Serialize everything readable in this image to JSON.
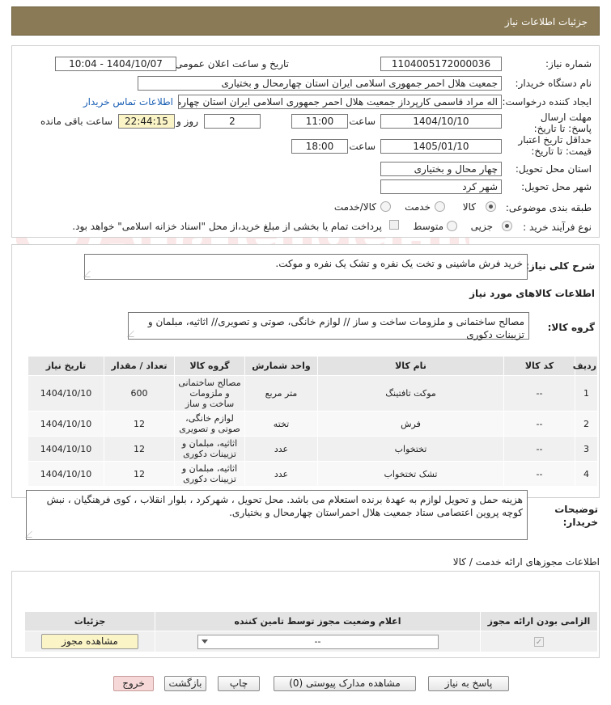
{
  "header": {
    "title": "جزئیات اطلاعات نیاز"
  },
  "fields": {
    "need_number_label": "شماره نیاز:",
    "need_number": "1104005172000036",
    "announce_label": "تاریخ و ساعت اعلان عمومی:",
    "announce_value": "1404/10/07 - 10:04",
    "buyer_org_label": "نام دستگاه خریدار:",
    "buyer_org": "جمعیت هلال احمر جمهوری اسلامی ایران استان چهارمحال و بختیاری",
    "requester_label": "ایجاد کننده درخواست:",
    "requester": "اله مراد قاسمی کارپرداز جمعیت هلال احمر جمهوری اسلامی ایران استان چهارمحال و بختیاری",
    "contact_link": "اطلاعات تماس خریدار",
    "reply_deadline_label": "مهلت ارسال پاسخ: تا تاریخ:",
    "reply_date": "1404/10/10",
    "time_label": "ساعت",
    "reply_time": "11:00",
    "days_value": "2",
    "days_and_label": "روز و",
    "remaining_time": "22:44:15",
    "remaining_label": "ساعت باقی مانده",
    "price_validity_label": "حداقل تاریخ اعتبار قیمت: تا تاریخ:",
    "validity_date": "1405/01/10",
    "validity_time": "18:00",
    "province_label": "استان محل تحویل:",
    "province": "چهار محال و بختیاری",
    "city_label": "شهر محل تحویل:",
    "city": "شهر کرد",
    "category_label": "طبقه بندی موضوعی:",
    "category_options": [
      "کالا",
      "خدمت",
      "کالا/خدمت"
    ],
    "process_label": "نوع فرآیند خرید :",
    "process_options": [
      "جزیی",
      "متوسط"
    ],
    "payment_note": "پرداخت تمام یا بخشی از مبلغ خرید،از محل \"اسناد خزانه اسلامی\" خواهد بود."
  },
  "description": {
    "label": "شرح کلی نیاز:",
    "text": "خرید فرش ماشینی و تخت یک نفره و تشک یک نفره و موکت."
  },
  "goods_info": {
    "title": "اطلاعات کالاهای مورد نیاز",
    "group_label": "گروه کالا:",
    "group_value": "مصالح ساختمانی و ملزومات ساخت و ساز // لوازم خانگی، صوتی و تصویری// اثاثیه، مبلمان و تزیینات دکوری"
  },
  "table": {
    "headers": [
      "ردیف",
      "کد کالا",
      "نام کالا",
      "واحد شمارش",
      "گروه کالا",
      "تعداد / مقدار",
      "تاریخ نیاز"
    ],
    "rows": [
      {
        "row": "1",
        "code": "--",
        "name": "موکت تافتینگ",
        "unit": "متر مربع",
        "group": "مصالح ساختمانی و ملزومات ساخت و ساز",
        "qty": "600",
        "date": "1404/10/10"
      },
      {
        "row": "2",
        "code": "--",
        "name": "فرش",
        "unit": "تخته",
        "group": "لوازم خانگی، صوتی و تصویری",
        "qty": "12",
        "date": "1404/10/10"
      },
      {
        "row": "3",
        "code": "--",
        "name": "تختخواب",
        "unit": "عدد",
        "group": "اثاثیه، مبلمان و تزیینات دکوری",
        "qty": "12",
        "date": "1404/10/10"
      },
      {
        "row": "4",
        "code": "--",
        "name": "تشک تختخواب",
        "unit": "عدد",
        "group": "اثاثیه، مبلمان و تزیینات دکوری",
        "qty": "12",
        "date": "1404/10/10"
      }
    ]
  },
  "buyer_notes": {
    "label": "توضیحات خریدار:",
    "text": "هزینه حمل و تحویل لوازم  به عهدۀ برنده استعلام می باشد. محل تحویل ، شهرکرد ، بلوار انقلاب ، کوی فرهنگیان ، نبش کوچه پروین اعتصامی ستاد جمعیت هلال احمراستان چهارمحال و بختیاری."
  },
  "permits": {
    "title": "اطلاعات مجوزهای ارائه خدمت / کالا",
    "headers": [
      "الزامی بودن ارائه مجوز",
      "اعلام وضعیت مجوز توسط تامین کننده",
      "جزئیات"
    ],
    "select_value": "--",
    "view_button": "مشاهده مجوز"
  },
  "buttons": {
    "reply": "پاسخ به نیاز",
    "attachments": "مشاهده مدارک پیوستی (0)",
    "print": "چاپ",
    "back": "بازگشت",
    "exit": "خروج"
  },
  "watermark": {
    "text": "AriaTender.neT"
  },
  "colors": {
    "header_bg": "#8a7a55",
    "link": "#1a5fb4",
    "highlight": "#fbf4c6"
  }
}
